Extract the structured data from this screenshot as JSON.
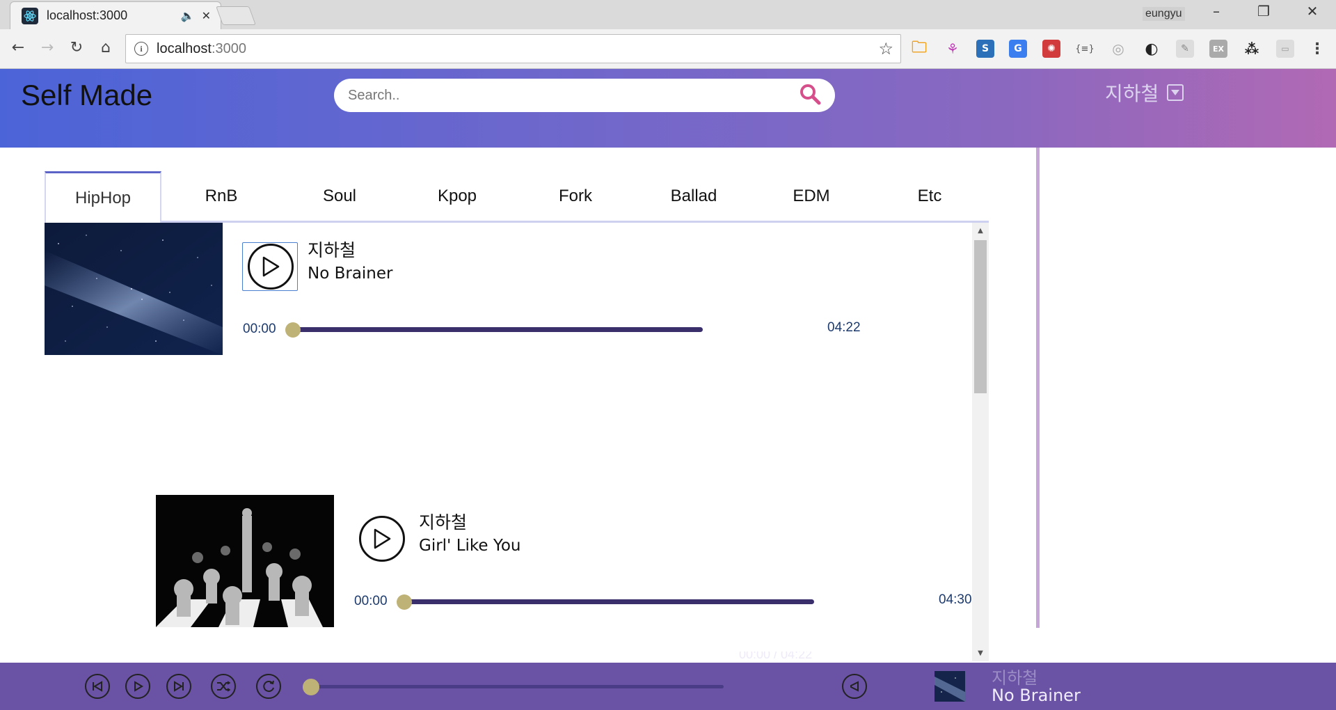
{
  "browser": {
    "tab_title": "localhost:3000",
    "user_name": "eungyu",
    "url_host": "localhost",
    "url_port": ":3000"
  },
  "app": {
    "brand": "Self Made",
    "search_placeholder": "Search..",
    "user_name": "지하철",
    "accent_color": "#5b63c6",
    "knob_color": "#bfb277"
  },
  "genre_tabs": [
    "HipHop",
    "RnB",
    "Soul",
    "Kpop",
    "Fork",
    "Ballad",
    "EDM",
    "Etc"
  ],
  "active_tab": "HipHop",
  "songs": [
    {
      "artist": "지하철",
      "title": "No Brainer",
      "current": "00:00",
      "duration": "04:22",
      "progress": 0,
      "cover": "galaxy"
    },
    {
      "artist": "지하철",
      "title": "Girl' Like You",
      "current": "00:00",
      "duration": "04:30",
      "progress": 0,
      "cover": "chess"
    }
  ],
  "player": {
    "time": "00:00 / 04:22",
    "artist": "지하철",
    "title": "No Brainer",
    "progress": 0
  }
}
